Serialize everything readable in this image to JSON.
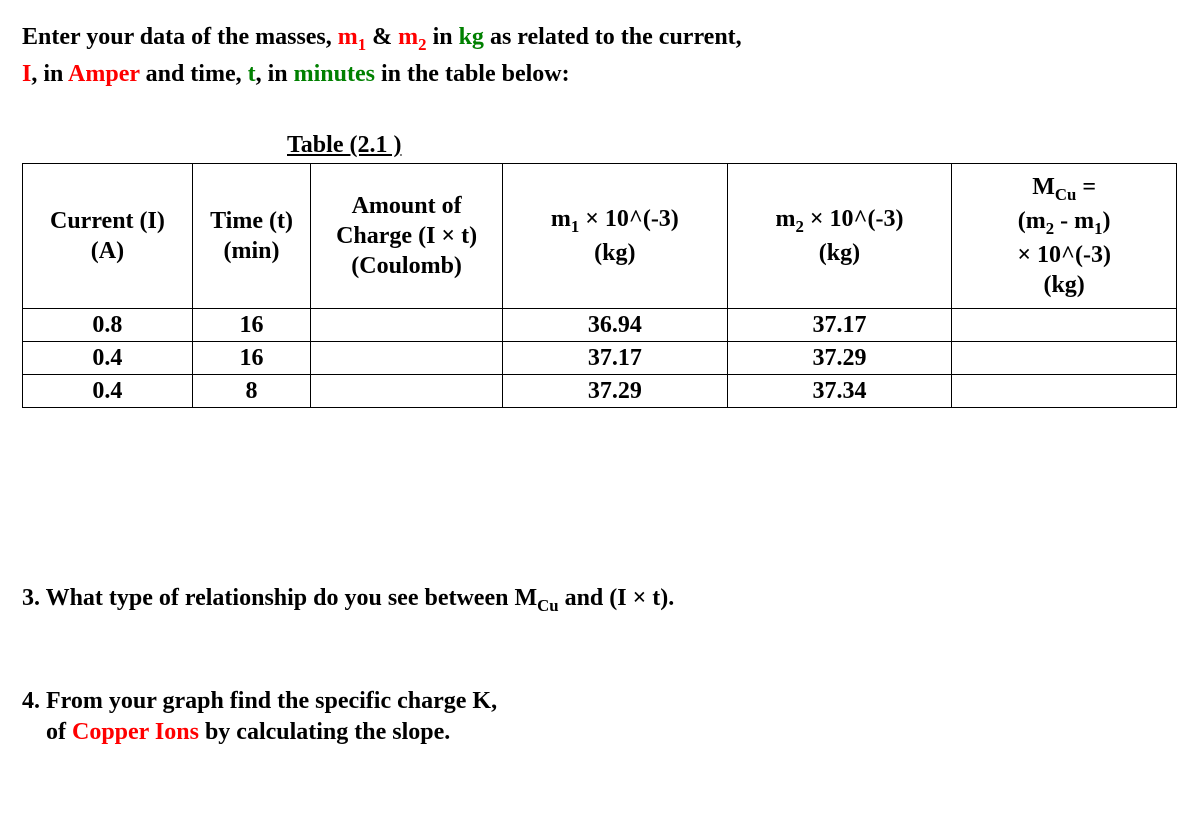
{
  "instruction": {
    "p1_a": "Enter your data of the masses, ",
    "p1_m1": "m",
    "p1_m1_sub": "1",
    "p1_b": " & ",
    "p1_m2": "m",
    "p1_m2_sub": "2",
    "p1_c": " in ",
    "p1_kg": "kg",
    "p1_d": " as related to the current,",
    "p2_a": "I",
    "p2_b": ", in ",
    "p2_amper": "Amper",
    "p2_c": " and time, ",
    "p2_t": "t",
    "p2_d": ", in ",
    "p2_min": "minutes",
    "p2_e": " in the table below:"
  },
  "table_caption": "Table (2.1 )",
  "headers": {
    "h1_l1": "Current (I)",
    "h1_l2": "(A)",
    "h2_l1": "Time (t)",
    "h2_l2": "(min)",
    "h3_l1": "Amount of",
    "h3_l2": "Charge (I × t)",
    "h3_l3": "(Coulomb)",
    "h4_l1a": "m",
    "h4_l1sub": "1",
    "h4_l1b": " × 10^(-3)",
    "h4_l2": "(kg)",
    "h5_l1a": "m",
    "h5_l1sub": "2",
    "h5_l1b": " × 10^(-3)",
    "h5_l2": "(kg)",
    "h6_l1a": "M",
    "h6_l1sub": "Cu",
    "h6_l1b": " =",
    "h6_l2a": "(m",
    "h6_l2sub1": "2",
    "h6_l2b": " - m",
    "h6_l2sub2": "1",
    "h6_l2c": ")",
    "h6_l3": "× 10^(-3)",
    "h6_l4": "(kg)"
  },
  "rows": [
    {
      "current": "0.8",
      "time": "16",
      "charge": "",
      "m1": "36.94",
      "m2": "37.17",
      "mcu": ""
    },
    {
      "current": "0.4",
      "time": "16",
      "charge": "",
      "m1": "37.17",
      "m2": "37.29",
      "mcu": ""
    },
    {
      "current": "0.4",
      "time": "8",
      "charge": "",
      "m1": "37.29",
      "m2": "37.34",
      "mcu": ""
    }
  ],
  "q3": {
    "a": "3. What type of relationship do you see between M",
    "sub": "Cu",
    "b": " and (I × t)."
  },
  "q4": {
    "l1": "4. From your graph find the specific charge K,",
    "l2a": "of ",
    "l2b": "Copper Ions",
    "l2c": " by calculating the slope."
  },
  "chart_data": {
    "type": "table",
    "title": "Table (2.1)",
    "columns": [
      "Current (I) (A)",
      "Time (t) (min)",
      "Amount of Charge (I × t) (Coulomb)",
      "m1 × 10^(-3) (kg)",
      "m2 × 10^(-3) (kg)",
      "MCu = (m2 - m1) × 10^(-3) (kg)"
    ],
    "rows": [
      [
        0.8,
        16,
        null,
        36.94,
        37.17,
        null
      ],
      [
        0.4,
        16,
        null,
        37.17,
        37.29,
        null
      ],
      [
        0.4,
        8,
        null,
        37.29,
        37.34,
        null
      ]
    ]
  }
}
